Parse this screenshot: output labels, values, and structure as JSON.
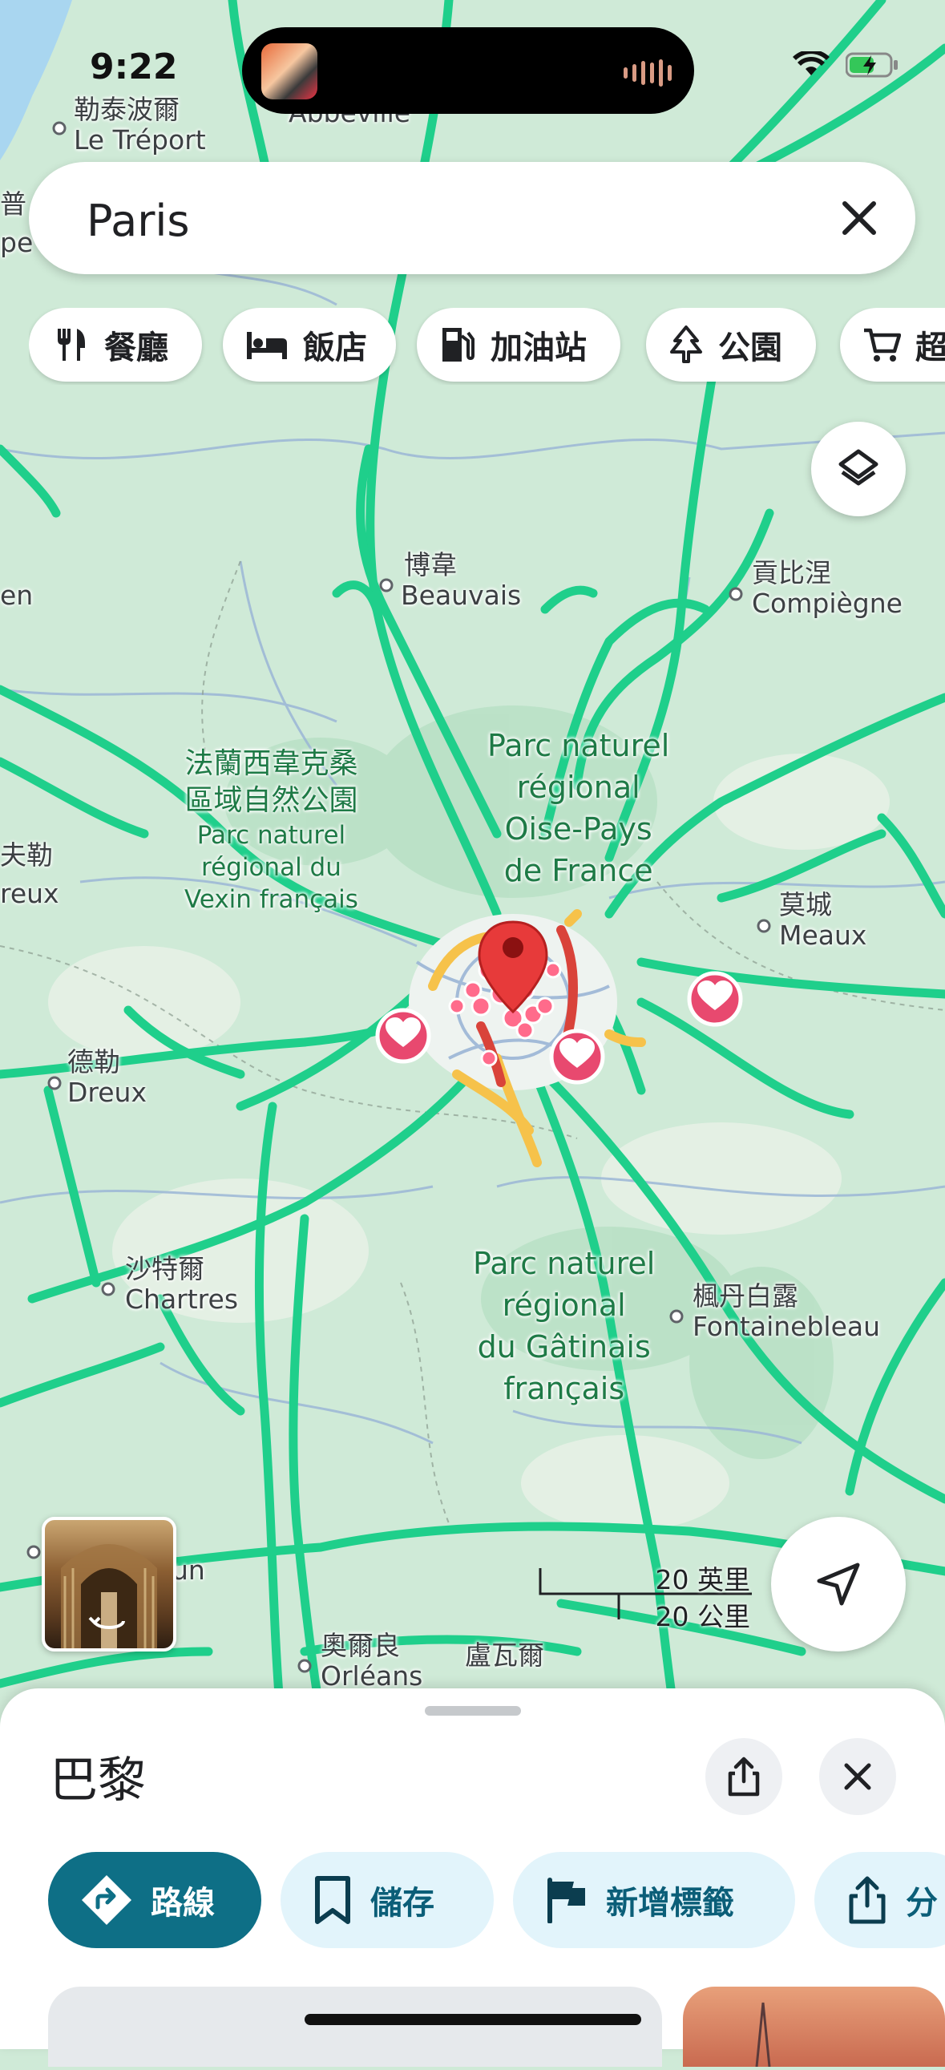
{
  "status_bar": {
    "time": "9:22"
  },
  "search": {
    "query": "Paris"
  },
  "chips": [
    {
      "label": "餐廳",
      "icon": "restaurant-icon"
    },
    {
      "label": "飯店",
      "icon": "hotel-icon"
    },
    {
      "label": "加油站",
      "icon": "gas-station-icon"
    },
    {
      "label": "公園",
      "icon": "park-icon"
    },
    {
      "label": "超",
      "icon": "shopping-cart-icon"
    }
  ],
  "map": {
    "towns": [
      {
        "zh": "勒泰波爾",
        "fr": "Le Tréport"
      },
      {
        "zh": "",
        "fr": "Abbeville"
      },
      {
        "zh": "博韋",
        "fr": "Beauvais"
      },
      {
        "zh": "貢比涅",
        "fr": "Compiègne"
      },
      {
        "zh": "莫城",
        "fr": "Meaux"
      },
      {
        "zh": "德勒",
        "fr": "Dreux"
      },
      {
        "zh": "沙特爾",
        "fr": "Chartres"
      },
      {
        "zh": "楓丹白露",
        "fr": "Fontainebleau"
      },
      {
        "zh": "奧爾良",
        "fr": "Orléans"
      },
      {
        "zh": "盧瓦爾",
        "fr": ""
      }
    ],
    "edge_labels": [
      "普",
      "pe",
      "en",
      "夫勒",
      "reux",
      "un"
    ],
    "parks": [
      {
        "zh": "法蘭西韋克桑\n區域自然公園",
        "fr": "Parc naturel\nrégional du\nVexin français"
      },
      {
        "zh": "",
        "fr": "Parc naturel\nrégional\nOise-Pays\nde France"
      },
      {
        "zh": "",
        "fr": "Parc naturel\nrégional\ndu Gâtinais\nfrançais"
      }
    ],
    "scale": {
      "imperial": "20 英里",
      "metric": "20 公里"
    },
    "accent_road": "#1fcf8b",
    "accent_traffic_red": "#d9433a",
    "accent_traffic_yellow": "#f6c24a"
  },
  "sheet": {
    "title": "巴黎",
    "actions": [
      {
        "label": "路線",
        "icon": "directions-icon"
      },
      {
        "label": "儲存",
        "icon": "bookmark-icon"
      },
      {
        "label": "新增標籤",
        "icon": "flag-icon"
      },
      {
        "label": "分",
        "icon": "share-icon"
      }
    ],
    "primary_color": "#0e6f86"
  }
}
